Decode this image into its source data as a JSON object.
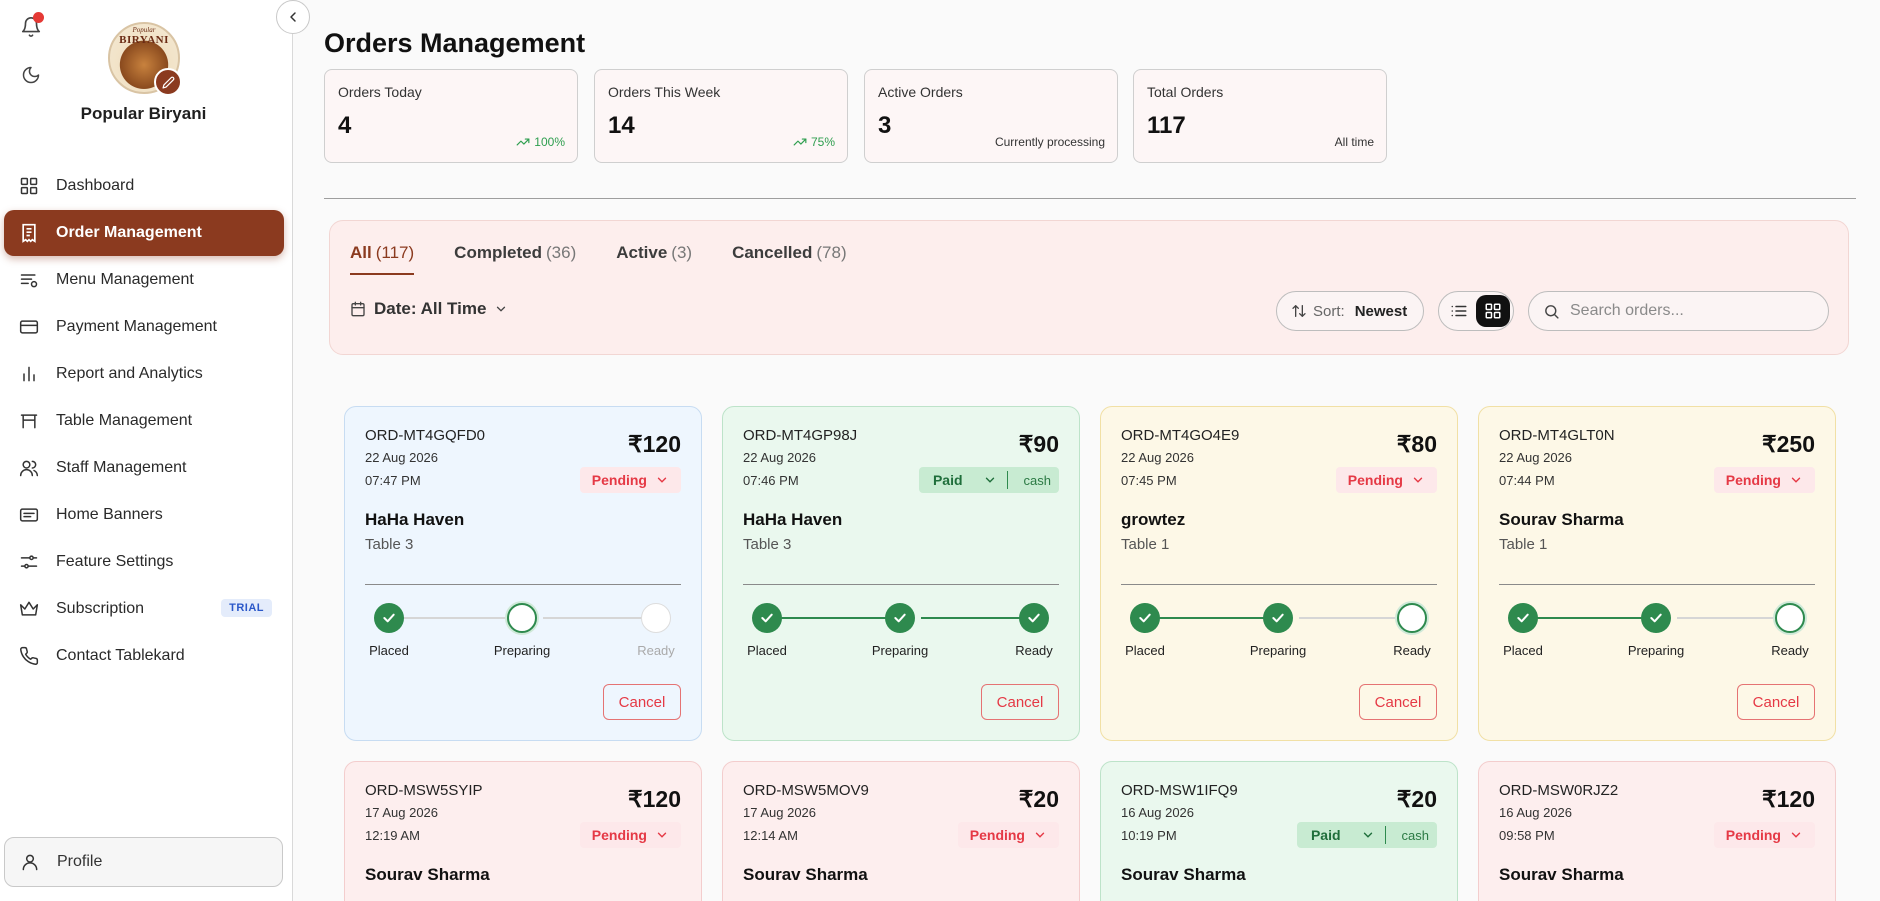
{
  "sidebar": {
    "brand_name": "Popular Biryani",
    "logo_script": "Popular",
    "logo_text": "BIRYANI",
    "items": [
      {
        "label": "Dashboard",
        "icon": "grid-icon"
      },
      {
        "label": "Order Management",
        "icon": "receipt-icon",
        "active": true
      },
      {
        "label": "Menu Management",
        "icon": "menu-list-icon"
      },
      {
        "label": "Payment Management",
        "icon": "credit-card-icon"
      },
      {
        "label": "Report and Analytics",
        "icon": "bar-chart-icon"
      },
      {
        "label": "Table Management",
        "icon": "table-icon"
      },
      {
        "label": "Staff Management",
        "icon": "users-icon"
      },
      {
        "label": "Home Banners",
        "icon": "banner-icon"
      },
      {
        "label": "Feature Settings",
        "icon": "sliders-icon"
      },
      {
        "label": "Subscription",
        "icon": "crown-icon",
        "badge": "TRIAL"
      },
      {
        "label": "Contact Tablekard",
        "icon": "phone-icon"
      }
    ],
    "profile_label": "Profile"
  },
  "header": {
    "title": "Orders Management"
  },
  "stats": [
    {
      "label": "Orders Today",
      "value": "4",
      "meta": "100%",
      "trend": "up"
    },
    {
      "label": "Orders This Week",
      "value": "14",
      "meta": "75%",
      "trend": "up"
    },
    {
      "label": "Active Orders",
      "value": "3",
      "meta": "Currently processing"
    },
    {
      "label": "Total Orders",
      "value": "117",
      "meta": "All time"
    }
  ],
  "filters": {
    "tabs": [
      {
        "label": "All",
        "count": "(117)",
        "active": true
      },
      {
        "label": "Completed",
        "count": "(36)"
      },
      {
        "label": "Active",
        "count": "(3)"
      },
      {
        "label": "Cancelled",
        "count": "(78)"
      }
    ],
    "date_label": "Date: All Time",
    "sort_label": "Sort:",
    "sort_value": "Newest",
    "search_placeholder": "Search orders..."
  },
  "colors": {
    "accent": "#8b3a1f",
    "success": "#2e8a4e",
    "danger": "#e53945"
  },
  "orders": [
    {
      "id": "ORD-MT4GQFD0",
      "date": "22 Aug 2026",
      "time": "07:47 PM",
      "amount": "₹120",
      "status": "Pending",
      "customer": "HaHa Haven",
      "table": "Table 3",
      "stage": 1,
      "theme": "blue",
      "cancel": "Cancel"
    },
    {
      "id": "ORD-MT4GP98J",
      "date": "22 Aug 2026",
      "time": "07:46 PM",
      "amount": "₹90",
      "status": "Paid",
      "method": "cash",
      "customer": "HaHa Haven",
      "table": "Table 3",
      "stage": 3,
      "theme": "green",
      "cancel": "Cancel"
    },
    {
      "id": "ORD-MT4GO4E9",
      "date": "22 Aug 2026",
      "time": "07:45 PM",
      "amount": "₹80",
      "status": "Pending",
      "customer": "growtez",
      "table": "Table 1",
      "stage": 2,
      "theme": "yellow",
      "cancel": "Cancel"
    },
    {
      "id": "ORD-MT4GLT0N",
      "date": "22 Aug 2026",
      "time": "07:44 PM",
      "amount": "₹250",
      "status": "Pending",
      "customer": "Sourav Sharma",
      "table": "Table 1",
      "stage": 2,
      "theme": "yellow",
      "cancel": "Cancel"
    },
    {
      "id": "ORD-MSW5SYIP",
      "date": "17 Aug 2026",
      "time": "12:19 AM",
      "amount": "₹120",
      "status": "Pending",
      "customer": "Sourav Sharma",
      "theme": "pink"
    },
    {
      "id": "ORD-MSW5MOV9",
      "date": "17 Aug 2026",
      "time": "12:14 AM",
      "amount": "₹20",
      "status": "Pending",
      "customer": "Sourav Sharma",
      "theme": "pink"
    },
    {
      "id": "ORD-MSW1IFQ9",
      "date": "16 Aug 2026",
      "time": "10:19 PM",
      "amount": "₹20",
      "status": "Paid",
      "method": "cash",
      "customer": "Sourav Sharma",
      "theme": "green"
    },
    {
      "id": "ORD-MSW0RJZ2",
      "date": "16 Aug 2026",
      "time": "09:58 PM",
      "amount": "₹120",
      "status": "Pending",
      "customer": "Sourav Sharma",
      "theme": "pink"
    }
  ],
  "step_labels": [
    "Placed",
    "Preparing",
    "Ready"
  ]
}
